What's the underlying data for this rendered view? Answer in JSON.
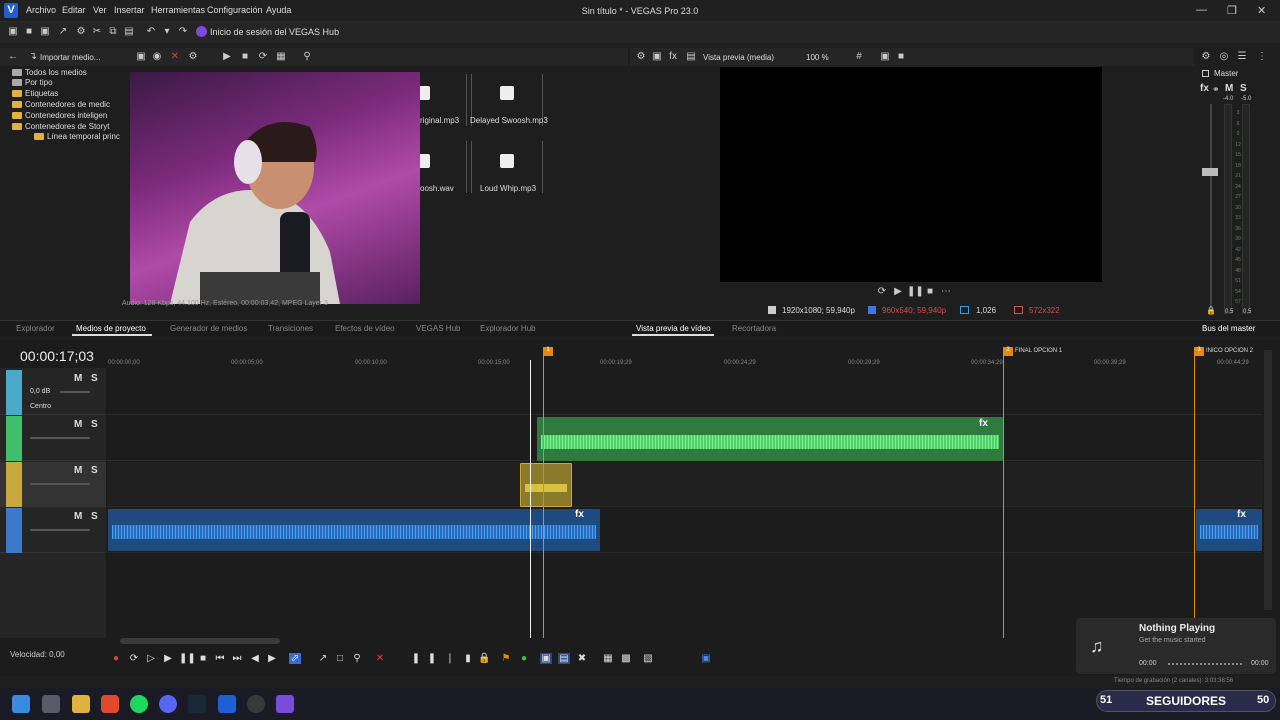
{
  "window": {
    "title": "Sin título * - VEGAS Pro 23.0",
    "app_icon": "V",
    "menu": [
      "Archivo",
      "Editar",
      "Ver",
      "Insertar",
      "Herramientas",
      "Configuración",
      "Ayuda"
    ]
  },
  "toolbar": {
    "hub_login": "Inicio de sesión del VEGAS Hub"
  },
  "explorer": {
    "import_label": "Importar medio...",
    "tree": [
      "Todos los medios",
      "Por tipo",
      "Etiquetas",
      "Contenedores de medic",
      "Contenedores inteligen",
      "Contenedores de Storyt",
      "Línea temporal princ"
    ],
    "files": [
      {
        "name": "riginal.mp3"
      },
      {
        "name": "Delayed Swoosh.mp3"
      },
      {
        "name": "oosh.wav"
      },
      {
        "name": "Loud Whip.mp3"
      }
    ],
    "audio_info": "Audio: 128 Kbps, 44.100 Hz, Estéreo, 00:00:03,42, MPEG Layer 3"
  },
  "preview": {
    "mode": "Vista previa (media)",
    "zoom": "100 %",
    "res": "1920x1080; 59,940p",
    "proj": "960x540; 59,940p",
    "ratio": "1,026",
    "size": "572x322"
  },
  "master": {
    "label": "Master",
    "db_left": "-4.0",
    "db_right": "-5.0",
    "bottom_left": "0.5",
    "bottom_right": "0.5",
    "fx": "fx",
    "m": "M",
    "s": "S",
    "scale": [
      "3",
      "6",
      "9",
      "12",
      "15",
      "18",
      "21",
      "24",
      "27",
      "30",
      "33",
      "36",
      "39",
      "42",
      "45",
      "48",
      "51",
      "54",
      "57"
    ]
  },
  "tabs": {
    "left": [
      "Explorador",
      "Medios de proyecto",
      "Generador de medios",
      "Transiciones",
      "Efectos de vídeo",
      "VEGAS Hub",
      "Explorador Hub"
    ],
    "active": "Medios de proyecto",
    "preview": "Vista previa de vídeo",
    "trimmer": "Recortadora",
    "master": "Bus del master"
  },
  "timeline": {
    "timecode": "00:00:17;03",
    "ruler": [
      "00:00:00;00",
      "00:00:05;00",
      "00:00:10;00",
      "00:00:15;00",
      "00:00:19;29",
      "00:00:24;29",
      "00:00:29;29",
      "00:00:34;29",
      "00:00:39;29",
      "00:00:44;29"
    ],
    "markers": [
      {
        "num": "1",
        "label": ""
      },
      {
        "num": "2",
        "label": "FINAL OPCION 1"
      },
      {
        "num": "3",
        "label": "INICO OPCION 2"
      }
    ],
    "track1": {
      "vol": "0,0 dB",
      "pan": "Centro",
      "m": "M",
      "s": "S"
    },
    "m": "M",
    "s": "S",
    "fx": "fx",
    "colors": {
      "t1": "#4aa8c8",
      "t2": "#3fbf6a",
      "t3": "#c8a83a",
      "t4": "#3a7ac8"
    }
  },
  "transport": {
    "speed": "Velocidad: 0,00"
  },
  "nowplaying": {
    "title": "Nothing Playing",
    "subtitle": "Get the music started",
    "start": "00:00",
    "end": "00:00"
  },
  "recording": "Tiempo de grabación (2 canales): 3:03:38:56",
  "followers": {
    "left": "51",
    "label": "SEGUIDORES",
    "right": "50"
  }
}
